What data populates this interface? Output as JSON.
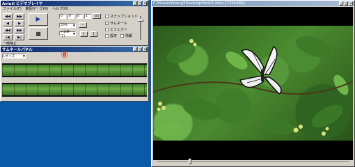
{
  "player": {
    "title": "Aviutl ビデオプレイヤ",
    "menu": [
      "ファイル(F)",
      "範囲マーク(R)",
      "ヘルプ(H)"
    ],
    "time_fields": [
      "0",
      "0",
      "0",
      "1"
    ],
    "go_label": "GO",
    "speed_value": "50%",
    "speed2_value": "+1(終了)",
    "bottom_label": "一時停止",
    "checks": [
      {
        "label": "スナップショット",
        "checked": false
      },
      {
        "label": "サムネール",
        "checked": true
      },
      {
        "label": "エフェクト",
        "checked": false
      },
      {
        "label": "設定",
        "checked": false
      },
      {
        "label": "情報",
        "checked": false
      }
    ]
  },
  "thumbs": {
    "title": "サムネールパネル",
    "size_value": "Lサイズ",
    "badge": "⑧"
  },
  "video": {
    "title": "C:¥Users¥wang¥Desktop¥test3.wmv [720x480]"
  }
}
